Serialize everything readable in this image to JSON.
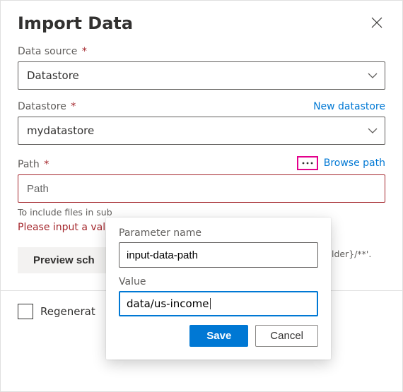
{
  "dialog": {
    "title": "Import Data"
  },
  "data_source": {
    "label": "Data source",
    "value": "Datastore"
  },
  "datastore": {
    "label": "Datastore",
    "new_link": "New datastore",
    "value": "mydatastore"
  },
  "path": {
    "label": "Path",
    "browse_link": "Browse path",
    "placeholder": "Path",
    "value": "",
    "hint_prefix": "To include files in sub",
    "hint_suffix": "lder}/**'.",
    "error": "Please input a val"
  },
  "preview_btn": "Preview sch",
  "footer": {
    "regenerate_label": "Regenerat"
  },
  "popover": {
    "param_label": "Parameter name",
    "param_value": "input-data-path",
    "value_label": "Value",
    "value_value": "data/us-income",
    "save_label": "Save",
    "cancel_label": "Cancel"
  }
}
